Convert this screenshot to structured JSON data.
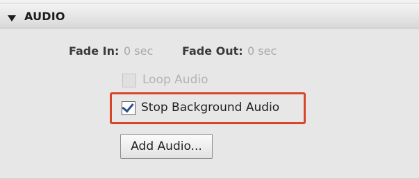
{
  "section": {
    "title": "AUDIO"
  },
  "fade": {
    "in_label": "Fade In:",
    "in_value": "0 sec",
    "out_label": "Fade Out:",
    "out_value": "0 sec"
  },
  "options": {
    "loop_audio": {
      "label": "Loop Audio",
      "checked": false,
      "enabled": false
    },
    "stop_background_audio": {
      "label": "Stop Background Audio",
      "checked": true,
      "enabled": true
    }
  },
  "buttons": {
    "add_audio": "Add Audio..."
  },
  "colors": {
    "highlight": "#d9452a",
    "checkmark": "#2d4f8a"
  }
}
